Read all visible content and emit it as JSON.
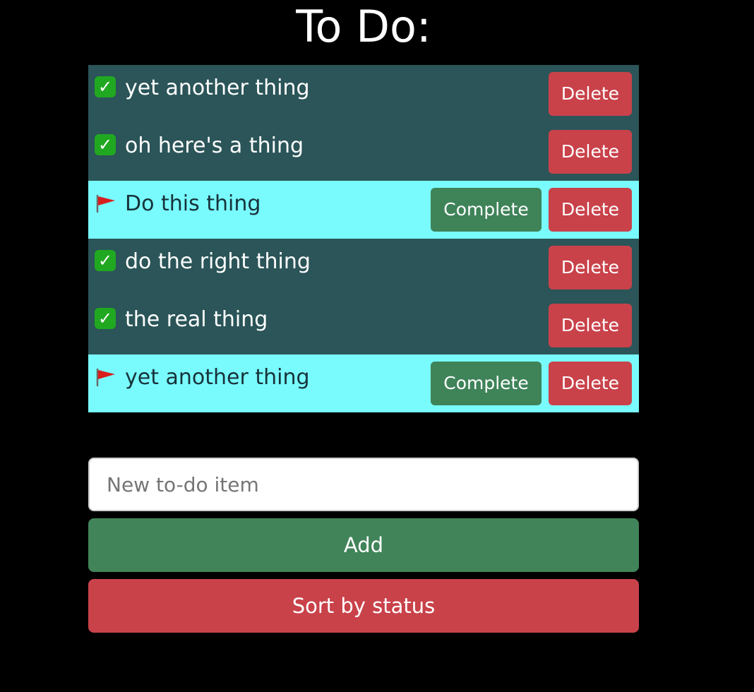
{
  "header": {
    "title": "To Do:"
  },
  "colors": {
    "background": "#000000",
    "completed_row": "#2b5558",
    "pending_row": "#79fbfd",
    "complete_button": "#3f8359",
    "delete_button": "#c9424a",
    "add_button": "#418459",
    "sort_button": "#c9424a"
  },
  "todos": [
    {
      "text": "yet another thing",
      "status": "completed",
      "icon": "check-mark-icon",
      "delete_label": "Delete"
    },
    {
      "text": "oh here's a thing",
      "status": "completed",
      "icon": "check-mark-icon",
      "delete_label": "Delete"
    },
    {
      "text": "Do this thing",
      "status": "pending",
      "icon": "red-flag-icon",
      "complete_label": "Complete",
      "delete_label": "Delete"
    },
    {
      "text": "do the right thing",
      "status": "completed",
      "icon": "check-mark-icon",
      "delete_label": "Delete"
    },
    {
      "text": "the real thing",
      "status": "completed",
      "icon": "check-mark-icon",
      "delete_label": "Delete"
    },
    {
      "text": "yet another thing",
      "status": "pending",
      "icon": "red-flag-icon",
      "complete_label": "Complete",
      "delete_label": "Delete"
    }
  ],
  "form": {
    "new_item_placeholder": "New to-do item",
    "new_item_value": "",
    "add_label": "Add",
    "sort_label": "Sort by status"
  }
}
